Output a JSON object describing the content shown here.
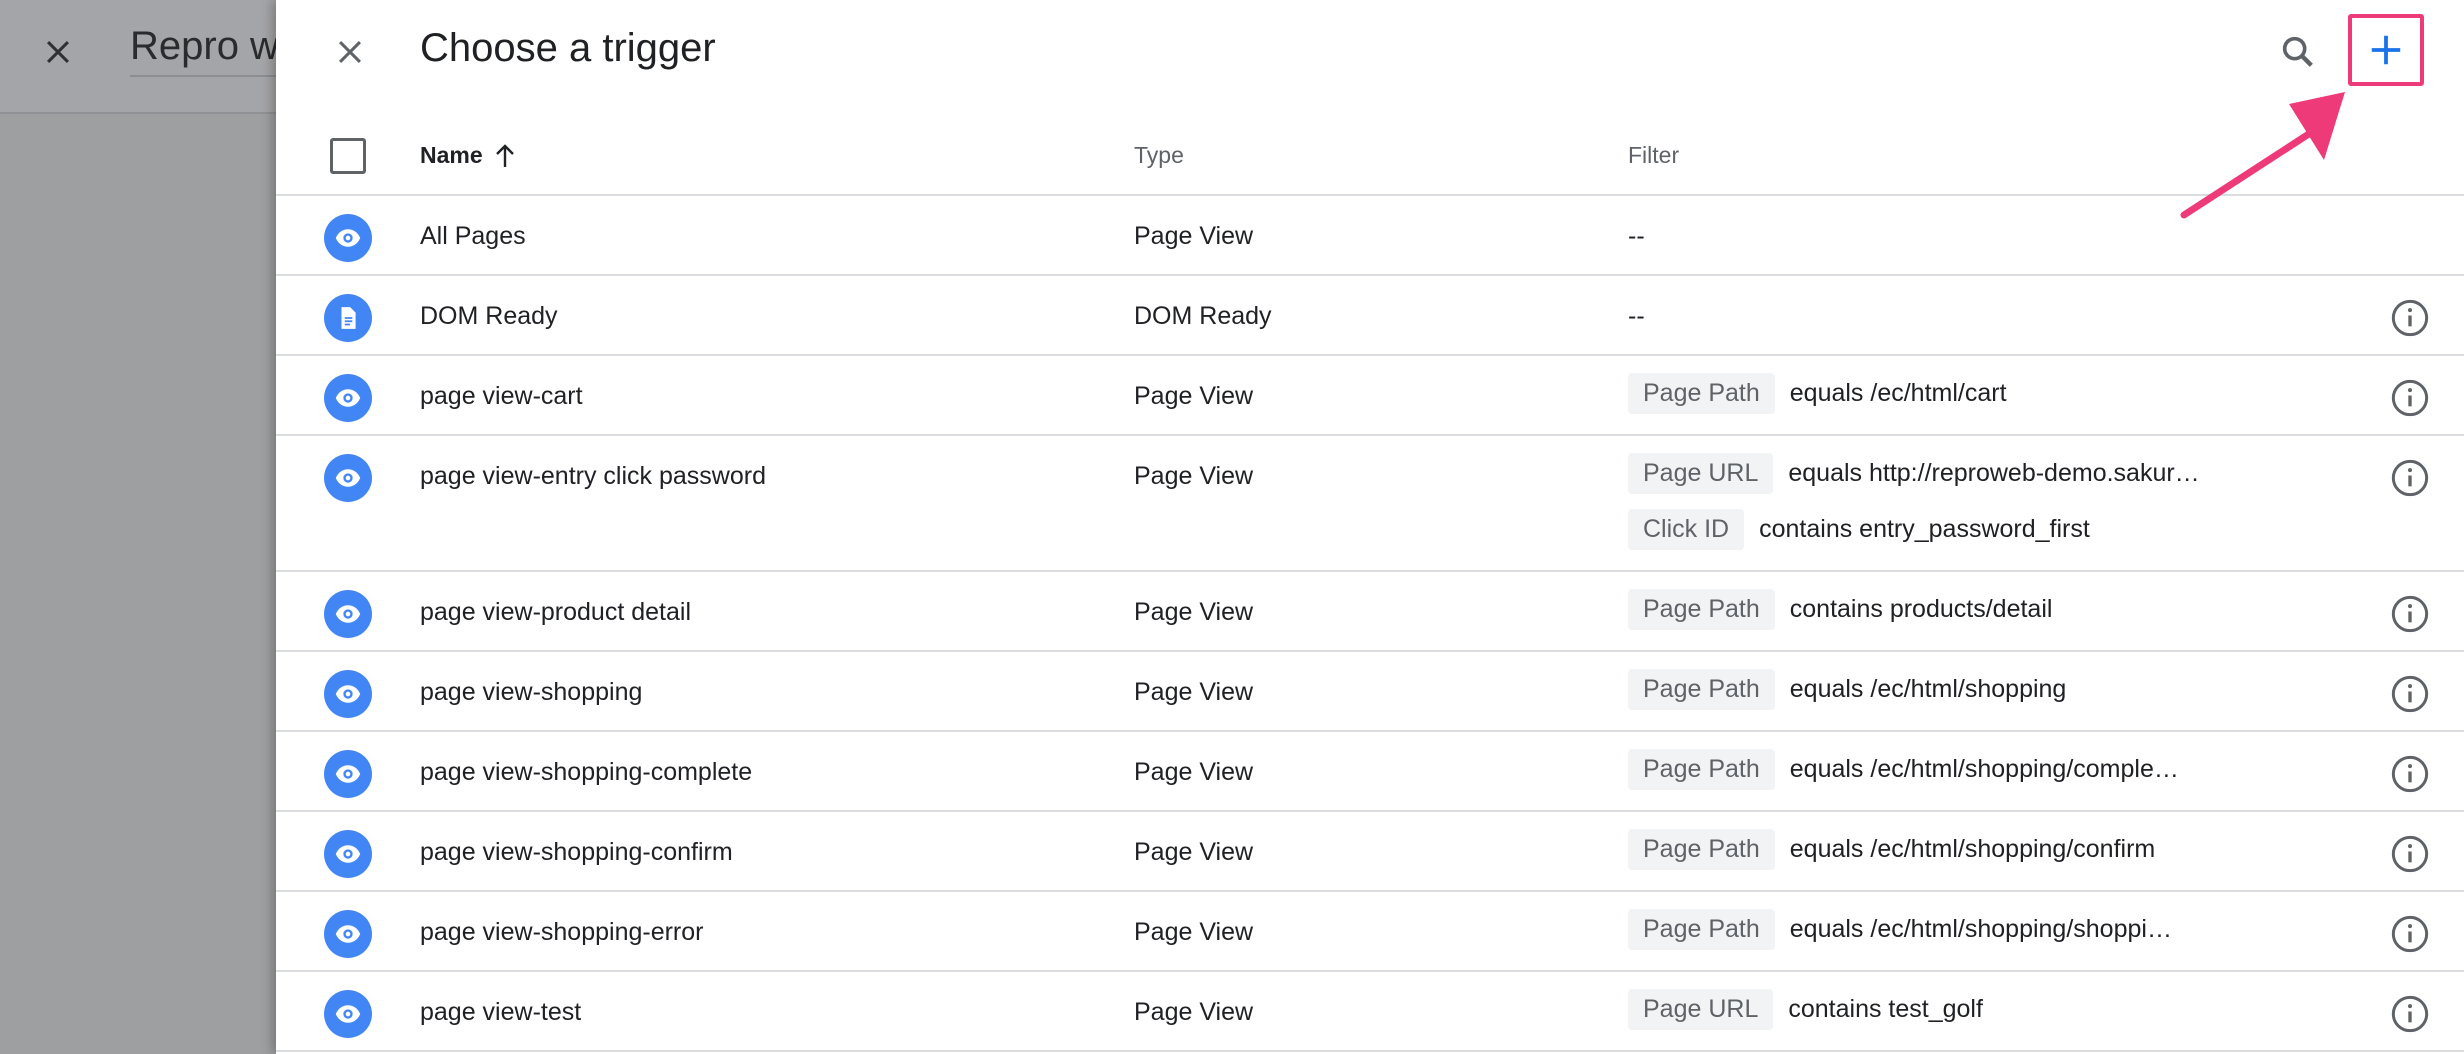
{
  "background": {
    "title": "Repro w"
  },
  "panel": {
    "title": "Choose a trigger"
  },
  "table": {
    "headers": {
      "name": "Name",
      "type": "Type",
      "filter": "Filter"
    },
    "rows": [
      {
        "icon": "eye-icon",
        "name": "All Pages",
        "type": "Page View",
        "filters": [],
        "empty": "--",
        "info": false
      },
      {
        "icon": "document-icon",
        "name": "DOM Ready",
        "type": "DOM Ready",
        "filters": [],
        "empty": "--",
        "info": true
      },
      {
        "icon": "eye-icon",
        "name": "page view-cart",
        "type": "Page View",
        "filters": [
          {
            "chip": "Page Path",
            "value": "equals /ec/html/cart"
          }
        ],
        "info": true
      },
      {
        "icon": "eye-icon",
        "name": "page view-entry click password",
        "type": "Page View",
        "filters": [
          {
            "chip": "Page URL",
            "value": "equals http://reproweb-demo.sakur…"
          },
          {
            "chip": "Click ID",
            "value": "contains entry_password_first"
          }
        ],
        "info": true
      },
      {
        "icon": "eye-icon",
        "name": "page view-product detail",
        "type": "Page View",
        "filters": [
          {
            "chip": "Page Path",
            "value": "contains products/detail"
          }
        ],
        "info": true
      },
      {
        "icon": "eye-icon",
        "name": "page view-shopping",
        "type": "Page View",
        "filters": [
          {
            "chip": "Page Path",
            "value": "equals /ec/html/shopping"
          }
        ],
        "info": true
      },
      {
        "icon": "eye-icon",
        "name": "page view-shopping-complete",
        "type": "Page View",
        "filters": [
          {
            "chip": "Page Path",
            "value": "equals /ec/html/shopping/comple…"
          }
        ],
        "info": true
      },
      {
        "icon": "eye-icon",
        "name": "page view-shopping-confirm",
        "type": "Page View",
        "filters": [
          {
            "chip": "Page Path",
            "value": "equals /ec/html/shopping/confirm"
          }
        ],
        "info": true
      },
      {
        "icon": "eye-icon",
        "name": "page view-shopping-error",
        "type": "Page View",
        "filters": [
          {
            "chip": "Page Path",
            "value": "equals /ec/html/shopping/shoppi…"
          }
        ],
        "info": true
      },
      {
        "icon": "eye-icon",
        "name": "page view-test",
        "type": "Page View",
        "filters": [
          {
            "chip": "Page URL",
            "value": "contains test_golf"
          }
        ],
        "info": true
      }
    ]
  },
  "colors": {
    "accent": "#4285f4",
    "highlight": "#ee3a79",
    "chip_bg": "#f1f3f4"
  }
}
